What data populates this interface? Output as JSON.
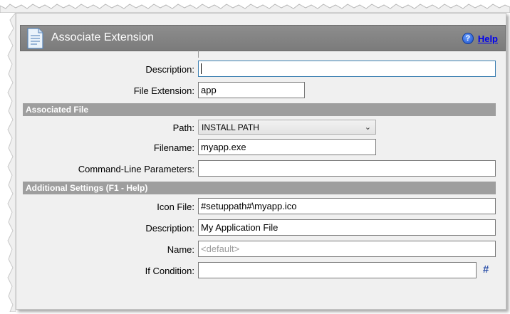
{
  "window": {
    "title": "Associate Extension",
    "help_label": "Help"
  },
  "fields": {
    "description": {
      "label": "Description:",
      "value": ""
    },
    "file_extension": {
      "label": "File Extension:",
      "value": "app"
    }
  },
  "associated_file": {
    "header": "Associated File",
    "path": {
      "label": "Path:",
      "value": "INSTALL PATH"
    },
    "filename": {
      "label": "Filename:",
      "value": "myapp.exe"
    },
    "cmdline": {
      "label": "Command-Line Parameters:",
      "value": ""
    }
  },
  "additional": {
    "header": "Additional Settings (F1 - Help)",
    "icon_file": {
      "label": "Icon File:",
      "value": "#setuppath#\\myapp.ico"
    },
    "description": {
      "label": "Description:",
      "value": "My Application File"
    },
    "name": {
      "label": "Name:",
      "placeholder": "<default>"
    },
    "if_condition": {
      "label": "If Condition:",
      "value": "",
      "button": "#"
    }
  }
}
